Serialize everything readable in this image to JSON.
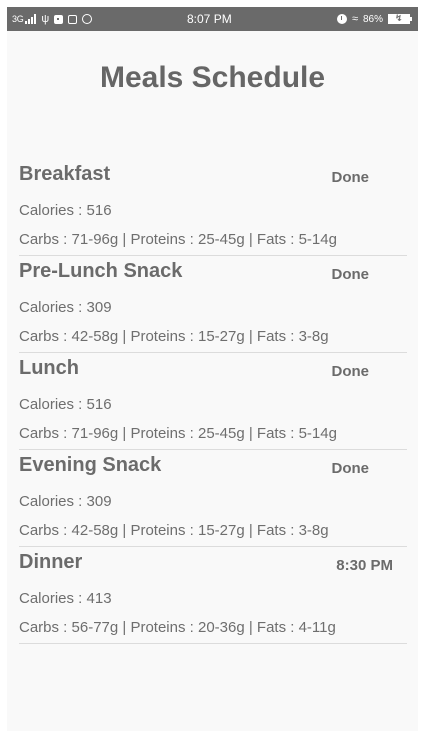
{
  "status_bar": {
    "network": "3G",
    "time": "8:07 PM",
    "battery": "86%",
    "icons": [
      "signal-icon",
      "usb-icon",
      "notification-icon",
      "gallery-icon",
      "whatsapp-icon",
      "alarm-icon",
      "wifi-icon",
      "battery-icon"
    ]
  },
  "header": {
    "title": "Meals Schedule"
  },
  "meals": [
    {
      "name": "Breakfast",
      "status": "Done",
      "calories": "Calories : 516",
      "macros": "Carbs : 71-96g | Proteins : 25-45g | Fats : 5-14g"
    },
    {
      "name": "Pre-Lunch Snack",
      "status": "Done",
      "calories": "Calories : 309",
      "macros": "Carbs : 42-58g | Proteins : 15-27g | Fats : 3-8g"
    },
    {
      "name": "Lunch",
      "status": "Done",
      "calories": "Calories : 516",
      "macros": "Carbs : 71-96g | Proteins : 25-45g | Fats : 5-14g"
    },
    {
      "name": "Evening Snack",
      "status": "Done",
      "calories": "Calories : 309",
      "macros": "Carbs : 42-58g | Proteins : 15-27g | Fats : 3-8g"
    },
    {
      "name": "Dinner",
      "status": "8:30 PM",
      "calories": "Calories : 413",
      "macros": "Carbs : 56-77g | Proteins : 20-36g | Fats : 4-11g"
    }
  ]
}
